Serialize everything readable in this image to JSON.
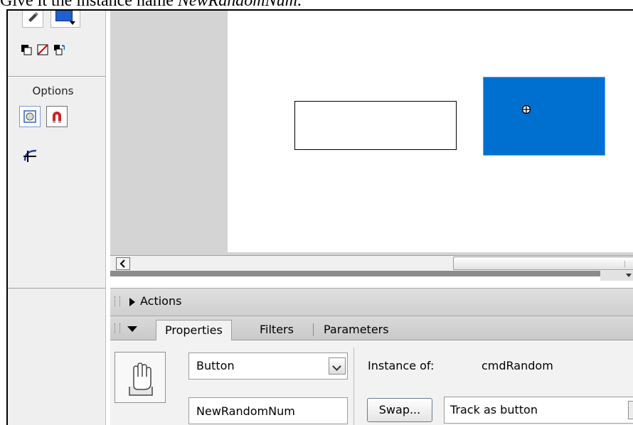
{
  "caption": {
    "prefix": "Give it the instance name ",
    "name": "NewRandomNum",
    "suffix": "."
  },
  "toolbox": {
    "options_label": "Options"
  },
  "colors": {
    "button_fill": "#0070d0",
    "fill_swatch": "#1f5fd0",
    "magnet_red": "#d02020"
  },
  "panels": {
    "actions_title": "Actions",
    "tabs": [
      "Properties",
      "Filters",
      "Parameters"
    ]
  },
  "properties": {
    "symbol_behavior": "Button",
    "instance_name": "NewRandomNum",
    "instance_of_label": "Instance of:",
    "instance_of_value": "cmdRandom",
    "swap_label": "Swap...",
    "track_option": "Track as button"
  }
}
